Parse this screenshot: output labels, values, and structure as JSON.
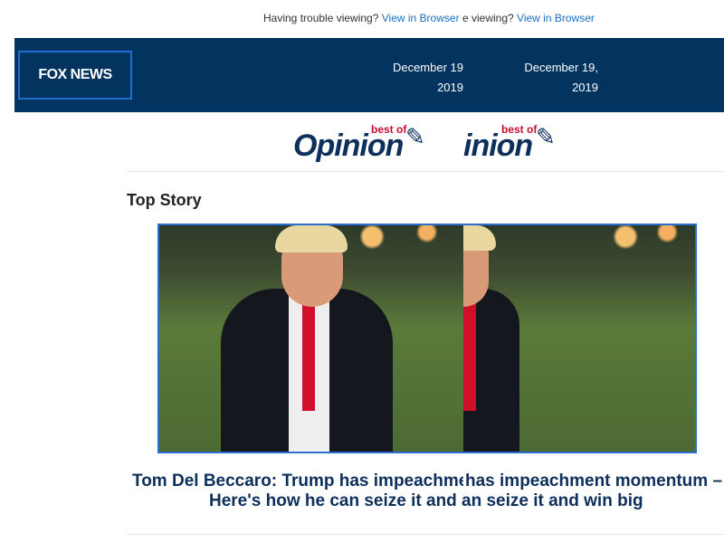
{
  "preheader": {
    "prefix": "Having trouble viewing?",
    "link": "View in Browser",
    "prefix_clipped": "e viewing?"
  },
  "header": {
    "logo": "FOX NEWS",
    "date_line1": "December 19,",
    "date_line2": "2019",
    "date_line1_clipped": "December 19",
    "date_line2_clipped": "2019"
  },
  "brand": {
    "best_of": "best of",
    "opinion": "Opinion",
    "opinion_clipped": "inion",
    "colors": {
      "navy": "#03335f",
      "accent": "#1f6ed4",
      "red": "#c8102e"
    }
  },
  "section": {
    "title": "Top Story"
  },
  "story": {
    "headline_line1_left": "Tom Del Beccaro: Trump has impeachme",
    "headline_line1_right": "has impeachment momentum –",
    "headline_line2_left": "Here's how he can seize it and v",
    "headline_line2_right": "an seize it and win big"
  }
}
